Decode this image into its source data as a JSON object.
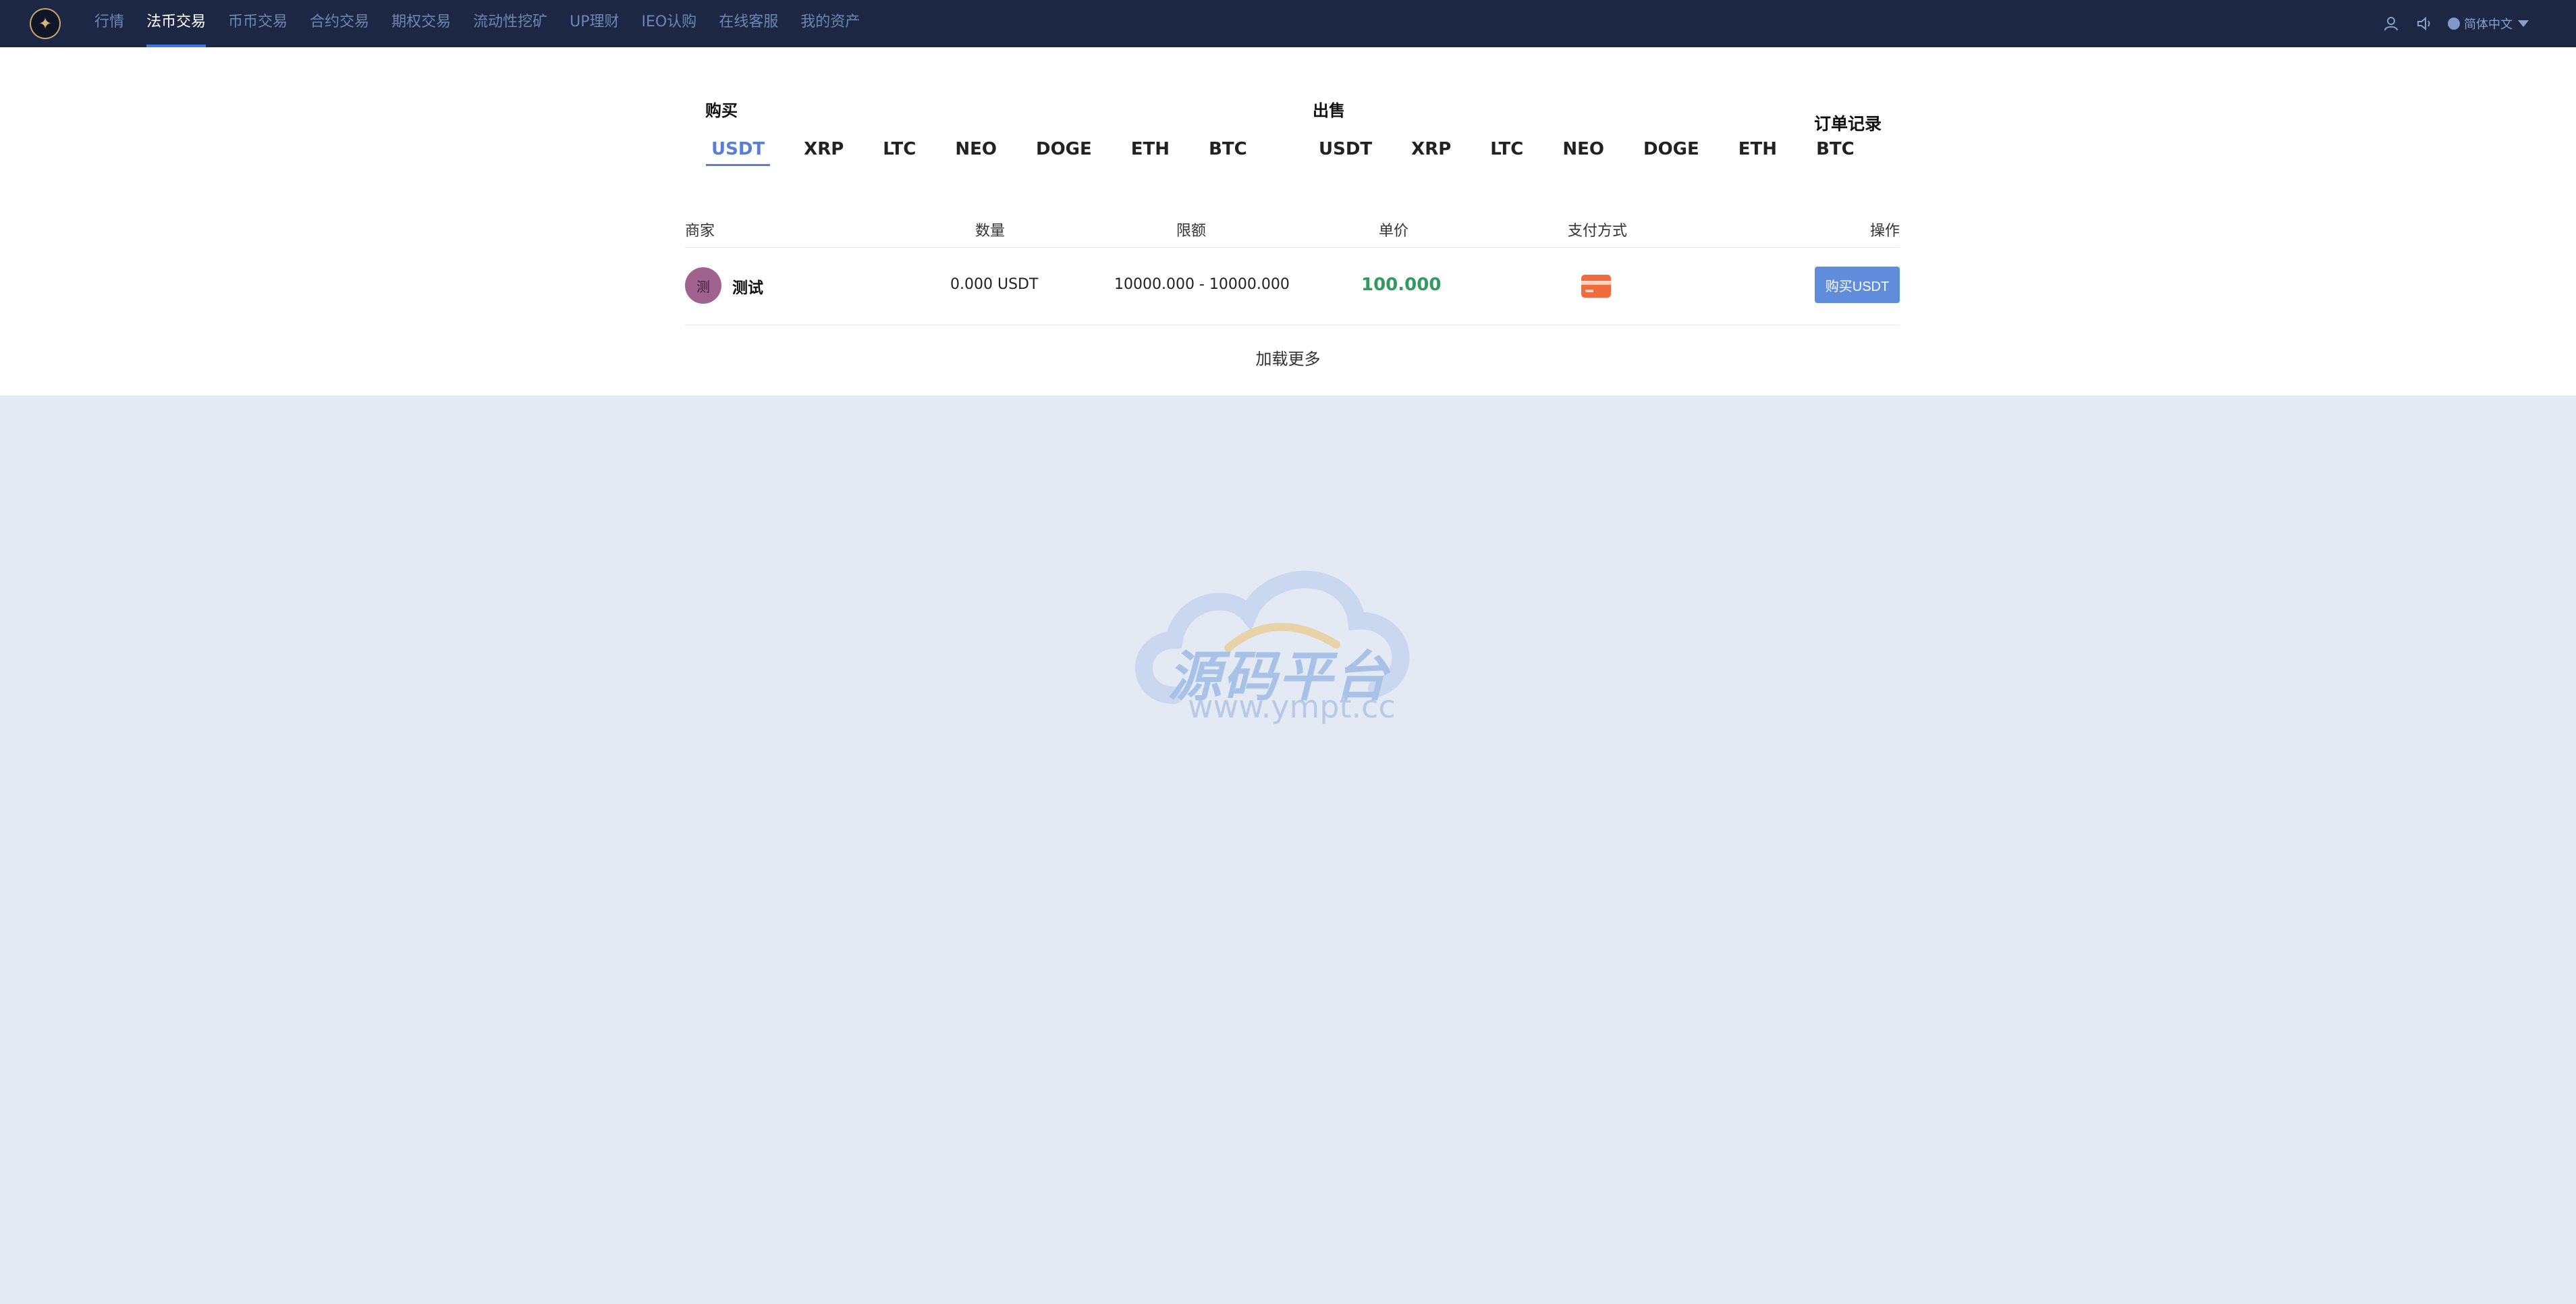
{
  "header": {
    "nav": [
      {
        "label": "行情"
      },
      {
        "label": "法币交易",
        "active": true
      },
      {
        "label": "币币交易"
      },
      {
        "label": "合约交易"
      },
      {
        "label": "期权交易"
      },
      {
        "label": "流动性挖矿"
      },
      {
        "label": "UP理财"
      },
      {
        "label": "IEO认购"
      },
      {
        "label": "在线客服"
      },
      {
        "label": "我的资产"
      }
    ],
    "icons": [
      "logo-icon",
      "user-icon",
      "speaker-icon",
      "globe-icon"
    ],
    "language": "简体中文"
  },
  "buy": {
    "title": "购买",
    "coins": [
      "USDT",
      "XRP",
      "LTC",
      "NEO",
      "DOGE",
      "ETH",
      "BTC"
    ],
    "active": "USDT"
  },
  "sell": {
    "title": "出售",
    "coins": [
      "USDT",
      "XRP",
      "LTC",
      "NEO",
      "DOGE",
      "ETH",
      "BTC"
    ]
  },
  "orders_link": "订单记录",
  "table": {
    "headers": {
      "merchant": "商家",
      "amount": "数量",
      "limit": "限额",
      "price": "单价",
      "payment": "支付方式",
      "action": "操作"
    },
    "rows": [
      {
        "avatar": "测",
        "merchant": "测试",
        "amount": "0.000 USDT",
        "limit": "10000.000 - 10000.000",
        "price": "100.000",
        "payment_icon": "card-icon",
        "action": "购买USDT"
      }
    ]
  },
  "load_more": "加载更多",
  "watermark": {
    "title": "源码平台",
    "url": "www.ympt.cc"
  },
  "colors": {
    "header_bg": "#1b2743",
    "accent": "#5a7ed6",
    "price_green": "#2e9c5e",
    "button_blue": "#5f8ddb",
    "page_bg": "#e4eaf4"
  }
}
